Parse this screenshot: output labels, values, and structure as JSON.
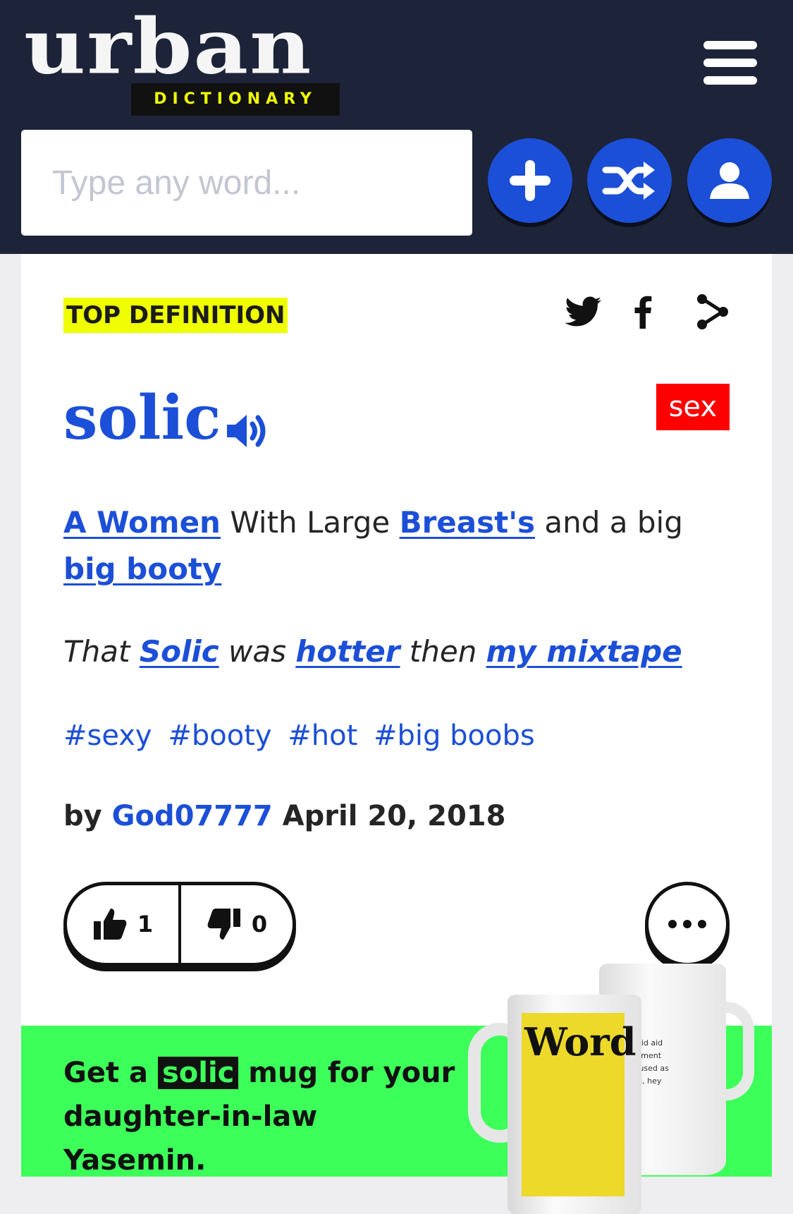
{
  "header": {
    "logo_main": "urban",
    "logo_sub": "DICTIONARY",
    "search_placeholder": "Type any word...",
    "buttons": [
      "plus-icon",
      "shuffle-icon",
      "user-icon"
    ]
  },
  "definition": {
    "badge": "TOP DEFINITION",
    "share_icons": [
      "twitter-icon",
      "facebook-icon",
      "share-icon"
    ],
    "word": "solic",
    "tag": "sex",
    "meaning": {
      "link1": "A Women",
      "text1": " With Large ",
      "link2": "Breast's",
      "text2": " and a big ",
      "link3": "big booty"
    },
    "example": {
      "text1": "That ",
      "link1": "Solic",
      "text2": " was ",
      "link2": "hotter",
      "text3": " then ",
      "link3": "my mixtape"
    },
    "hashtags": [
      "#sexy",
      "#booty",
      "#hot",
      "#big boobs"
    ],
    "contributor": {
      "prefix": "by ",
      "author": "God07777",
      "date": " April 20, 2018"
    },
    "votes": {
      "up": "1",
      "down": "0"
    }
  },
  "promo": {
    "text_before": "Get a ",
    "highlight": "solic",
    "text_after": " mug for your daughter-in-law Yasemin.",
    "mug_front_word": "Word",
    "mug_back_text": "well said aid in a eement an be used as reeting, hey ats up"
  },
  "colors": {
    "header_bg": "#1d2439",
    "accent_blue": "#1c4fd8",
    "badge_yellow": "#efff00",
    "tag_red": "#ff0000",
    "promo_green": "#3dff5a"
  }
}
